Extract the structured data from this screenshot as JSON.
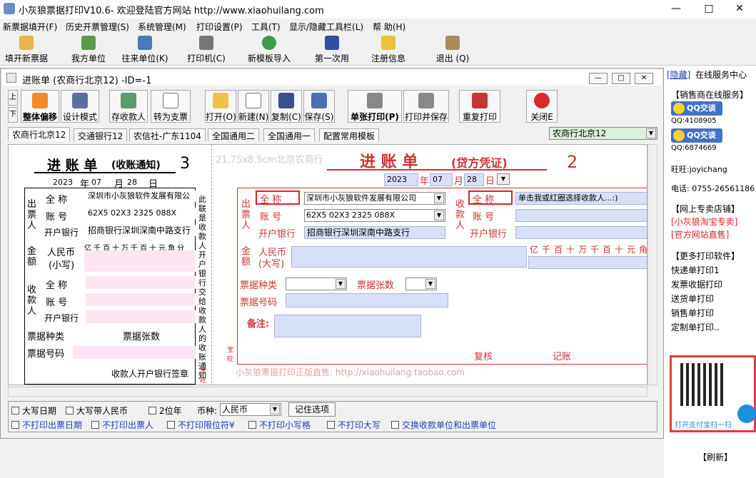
{
  "window": {
    "title": "小灰狼票据打印V10.6- 欢迎登陆官方网站 http://www.xiaohuilang.com"
  },
  "menu": [
    "新票据填开(F)",
    "历史开票管理(S)",
    "系统管理(M)",
    "打印设置(P)",
    "工具(T)",
    "显示/隐藏工具栏(L)",
    "帮 助(H)"
  ],
  "toolbar": [
    "填开新票据",
    "我方单位",
    "往来单位(K)",
    "打印机(C)",
    "新模板导入",
    "第一次用",
    "注册信息",
    "退出 (Q)"
  ],
  "doc": {
    "title": "进账单 (农商行北京12) -ID=-1",
    "scroll_up": "上",
    "scroll_down": "下",
    "buttons": [
      "整体偏移",
      "设计模式",
      "存收款人",
      "转为支票",
      "打开(O)",
      "新建(N)",
      "复制(C)",
      "保存(S)",
      "单张打印(P)",
      "打印并保存",
      "重复打印",
      "关闭E"
    ],
    "tabs": [
      "农商行北京12",
      "交通银行12",
      "农信社-广东1104",
      "全国通用二",
      "全国通用一",
      "配置常用模板"
    ],
    "selected_template": "农商行北京12"
  },
  "form": {
    "left": {
      "title": "进 账 单",
      "subtitle": "(收账通知)",
      "number": "3",
      "date_year": "2023",
      "year_label": "年",
      "date_month": "07",
      "month_label": "月",
      "date_day": "28",
      "day_label": "日",
      "payer_label": "出票人",
      "payee_label": "收款人",
      "full_name": "全 称",
      "account": "账 号",
      "bank": "开户银行",
      "payer_name": "深圳市小灰狼软件发展有限公",
      "payer_account": "62X5 02X3 2325 088X",
      "payer_bank": "招商银行深圳深南中路支行",
      "amount_label": "金额",
      "rmb_label": "人民币",
      "rmb_sub": "(小写)",
      "digits": "亿千百十万千百十元角分",
      "bill_type": "票据种类",
      "bill_count": "票据张数",
      "bill_no": "票据号码",
      "footer": "收款人开户银行签章",
      "vertical_note": "此联是收款人开户银行交给收款人的收账通知",
      "side_text": "宝旺"
    },
    "right": {
      "watermark": "21.75x8.5cm北京农商行",
      "title": "进 账 单",
      "subtitle": "(贷方凭证)",
      "number": "2",
      "date_year": "2023",
      "year_label": "年",
      "date_month": "07",
      "month_label": "月",
      "date_day": "28",
      "day_label": "日",
      "payer_label": "出票人",
      "payee_label": "收款人",
      "full_name": "全 称",
      "account": "账 号",
      "bank": "开户银行",
      "payer_name": "深圳市小灰狼软件发展有限公司",
      "payer_account": "62X5 02X3 2325 088X",
      "payer_bank": "招商银行深圳深南中路支行",
      "payee_placeholder": "单击我或红圈选择收款人...:)",
      "amount_label": "金额",
      "rmb_label": "人民币",
      "rmb_sub": "(大写)",
      "digits": "亿千百十万千百十元角",
      "bill_type": "票据种类",
      "bill_count": "票据张数",
      "bill_no": "票据号码",
      "remark": "备注:",
      "review": "复核",
      "bookkeep": "记账",
      "ad": "小灰狼票据打印正版直售: http://xiaohuilang.taobao.com",
      "side_text": "宝旺"
    }
  },
  "options": {
    "row1": [
      "大写日期",
      "大写带人民币",
      "2位年"
    ],
    "currency_label": "币种:",
    "currency": "人民币",
    "remember": "记住选项",
    "row2": [
      "不打印出票日期",
      "不打印出票人",
      "不打印限位符¥",
      "不打印小写格",
      "不打印大写",
      "交换收款单位和出票单位"
    ]
  },
  "sidebar": {
    "hide": "[隐藏]",
    "service": "在线服务中心",
    "sales_online": "【销售商在线服务】",
    "qq_btn": "QQ交谈",
    "qq1": "QQ:4108905",
    "qq2": "QQ:6874669",
    "wangwang": "旺旺:joyichang",
    "phone": "电话: 0755-26561186",
    "shop_title": "【网上专卖店铺】",
    "taobao": "[小灰狼淘宝专卖]",
    "official": "[官方网站直售]",
    "more_title": "【更多打印软件】",
    "products": [
      "快递单打印1",
      "发票收据打印",
      "送货单打印",
      "销售单打印",
      "定制单打印.."
    ],
    "alipay": "打开支付宝扫一扫",
    "refresh": "【刷新】"
  }
}
